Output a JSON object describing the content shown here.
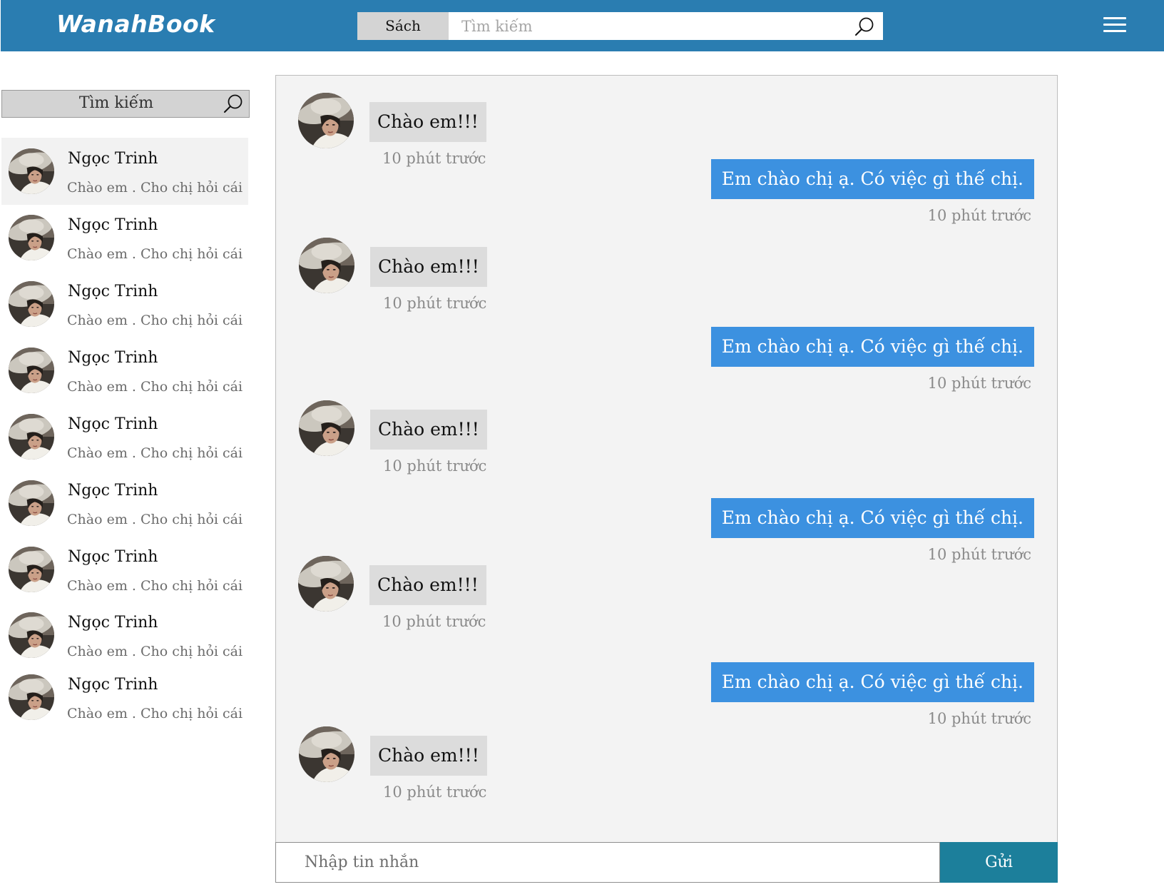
{
  "header": {
    "logo": "WanahBook",
    "category_label": "Sách",
    "search_placeholder": "Tìm kiếm",
    "bg_color": "#2a7db1"
  },
  "sidebar": {
    "search_label": "Tìm kiếm",
    "contacts": [
      {
        "name": "Ngọc Trinh",
        "preview": "Chào em . Cho chị hỏi cái"
      },
      {
        "name": "Ngọc Trinh",
        "preview": "Chào em . Cho chị hỏi cái"
      },
      {
        "name": "Ngọc Trinh",
        "preview": "Chào em . Cho chị hỏi cái"
      },
      {
        "name": "Ngọc Trinh",
        "preview": "Chào em . Cho chị hỏi cái"
      },
      {
        "name": "Ngọc Trinh",
        "preview": "Chào em . Cho chị hỏi cái"
      },
      {
        "name": "Ngọc Trinh",
        "preview": "Chào em . Cho chị hỏi cái"
      },
      {
        "name": "Ngọc Trinh",
        "preview": "Chào em . Cho chị hỏi cái"
      },
      {
        "name": "Ngọc Trinh",
        "preview": "Chào em . Cho chị hỏi cái"
      },
      {
        "name": "Ngọc Trinh",
        "preview": "Chào em . Cho chị hỏi cái"
      }
    ]
  },
  "chat": {
    "messages": [
      {
        "direction": "incoming",
        "text": "Chào em!!!",
        "time": "10 phút trước"
      },
      {
        "direction": "outgoing",
        "text": "Em chào chị ạ. Có việc gì thế chị.",
        "time": "10 phút trước"
      },
      {
        "direction": "incoming",
        "text": "Chào em!!!",
        "time": "10 phút trước"
      },
      {
        "direction": "outgoing",
        "text": "Em chào chị ạ. Có việc gì thế chị.",
        "time": "10 phút trước"
      },
      {
        "direction": "incoming",
        "text": "Chào em!!!",
        "time": "10 phút trước"
      },
      {
        "direction": "outgoing",
        "text": "Em chào chị ạ. Có việc gì thế chị.",
        "time": "10 phút trước"
      },
      {
        "direction": "incoming",
        "text": "Chào em!!!",
        "time": "10 phút trước"
      },
      {
        "direction": "outgoing",
        "text": "Em chào chị ạ. Có việc gì thế chị.",
        "time": "10 phút trước"
      },
      {
        "direction": "incoming",
        "text": "Chào em!!!",
        "time": "10 phút trước"
      }
    ],
    "outgoing_color": "#3c91e0",
    "incoming_color": "#dcdcdc"
  },
  "composer": {
    "placeholder": "Nhập tin nhắn",
    "send_label": "Gửi",
    "send_color": "#1c7f9b"
  }
}
